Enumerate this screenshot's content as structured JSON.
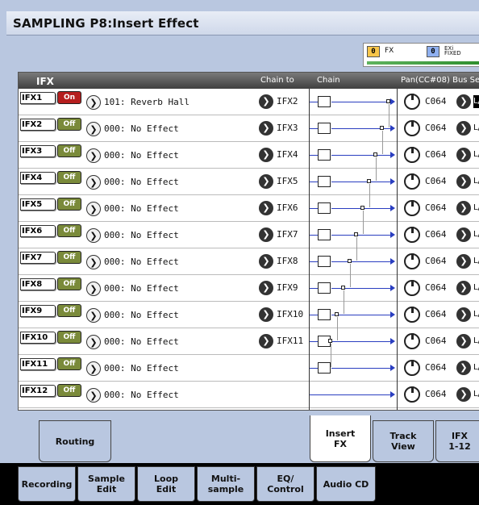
{
  "header": {
    "title": "SAMPLING P8:Insert Effect"
  },
  "fx_indicator": {
    "fx_num": "0",
    "fx_label": "FX",
    "exi_num": "0",
    "exi_label_top": "EXi",
    "exi_label_bottom": "FIXED"
  },
  "table_header": {
    "ifx": "IFX",
    "chain_to": "Chain to",
    "chain": "Chain",
    "pan_bus": "Pan(CC#08) Bus Se"
  },
  "rows": [
    {
      "label": "IFX1",
      "state": "On",
      "effect": "101: Reverb Hall",
      "chain_to": "IFX2",
      "pan": "C064",
      "bus": "L/"
    },
    {
      "label": "IFX2",
      "state": "Off",
      "effect": "000: No Effect",
      "chain_to": "IFX3",
      "pan": "C064",
      "bus": "L/"
    },
    {
      "label": "IFX3",
      "state": "Off",
      "effect": "000: No Effect",
      "chain_to": "IFX4",
      "pan": "C064",
      "bus": "L/"
    },
    {
      "label": "IFX4",
      "state": "Off",
      "effect": "000: No Effect",
      "chain_to": "IFX5",
      "pan": "C064",
      "bus": "L/"
    },
    {
      "label": "IFX5",
      "state": "Off",
      "effect": "000: No Effect",
      "chain_to": "IFX6",
      "pan": "C064",
      "bus": "L/"
    },
    {
      "label": "IFX6",
      "state": "Off",
      "effect": "000: No Effect",
      "chain_to": "IFX7",
      "pan": "C064",
      "bus": "L/"
    },
    {
      "label": "IFX7",
      "state": "Off",
      "effect": "000: No Effect",
      "chain_to": "IFX8",
      "pan": "C064",
      "bus": "L/"
    },
    {
      "label": "IFX8",
      "state": "Off",
      "effect": "000: No Effect",
      "chain_to": "IFX9",
      "pan": "C064",
      "bus": "L/"
    },
    {
      "label": "IFX9",
      "state": "Off",
      "effect": "000: No Effect",
      "chain_to": "IFX10",
      "pan": "C064",
      "bus": "L/"
    },
    {
      "label": "IFX10",
      "state": "Off",
      "effect": "000: No Effect",
      "chain_to": "IFX11",
      "pan": "C064",
      "bus": "L/"
    },
    {
      "label": "IFX11",
      "state": "Off",
      "effect": "000: No Effect",
      "chain_to": "",
      "pan": "C064",
      "bus": "L/"
    },
    {
      "label": "IFX12",
      "state": "Off",
      "effect": "000: No Effect",
      "chain_to": "",
      "pan": "C064",
      "bus": "L/"
    }
  ],
  "page_tabs": {
    "routing": "Routing",
    "insert_fx_1": "Insert",
    "insert_fx_2": "FX",
    "track_view_1": "Track",
    "track_view_2": "View",
    "ifx_1_12_1": "IFX",
    "ifx_1_12_2": "1-12"
  },
  "mode_tabs": {
    "recording": "Recording",
    "sample_edit_1": "Sample",
    "sample_edit_2": "Edit",
    "loop_edit_1": "Loop",
    "loop_edit_2": "Edit",
    "multi_sample_1": "Multi-",
    "multi_sample_2": "sample",
    "eq_control_1": "EQ/",
    "eq_control_2": "Control",
    "audio_cd": "Audio CD"
  },
  "colors": {
    "background": "#b9c7e0",
    "on_button": "#b51e1e",
    "off_button": "#7a8a3a",
    "chain_line": "#2a3ec0",
    "fx_indicator": "#f7c54a",
    "exi_indicator": "#8fb0f0"
  }
}
